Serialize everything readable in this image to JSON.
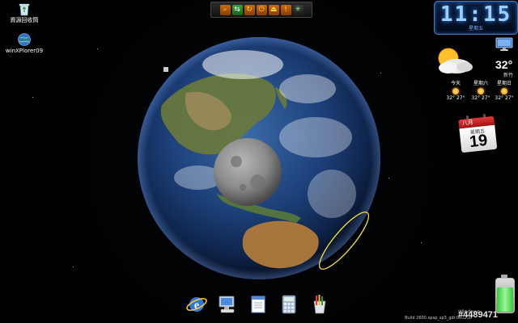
{
  "desktop": {
    "icons": [
      {
        "name": "recycle-bin",
        "label": "資源回收筒",
        "icon": "recycle-bin-icon"
      },
      {
        "name": "winxplorer",
        "label": "winXPlorer09",
        "icon": "globe-icon"
      }
    ]
  },
  "quick_bar": {
    "buttons": [
      {
        "icon": "search-icon",
        "glyph": "⌕"
      },
      {
        "icon": "swap-icon",
        "glyph": "⇆"
      },
      {
        "icon": "refresh-icon",
        "glyph": "↻"
      },
      {
        "icon": "power-icon",
        "glyph": "⏻"
      },
      {
        "icon": "eject-icon",
        "glyph": "⏏"
      },
      {
        "icon": "alert-icon",
        "glyph": "!"
      },
      {
        "icon": "settings-icon",
        "glyph": "✳"
      }
    ]
  },
  "clock": {
    "time": "11:15",
    "subtitle": "星期五"
  },
  "weather": {
    "temperature": "32°",
    "location": "新竹",
    "condition_icon": "partly-cloudy-icon",
    "forecast": [
      {
        "day": "今天",
        "high_low": "32° 27°"
      },
      {
        "day": "星期六",
        "high_low": "32° 27°"
      },
      {
        "day": "星期日",
        "high_low": "32° 27°"
      }
    ]
  },
  "calendar": {
    "month": "八月",
    "weekday": "星期五",
    "day": "19"
  },
  "dock": {
    "items": [
      {
        "icon": "internet-explorer-icon"
      },
      {
        "icon": "my-computer-icon"
      },
      {
        "icon": "notepad-icon"
      },
      {
        "icon": "calculator-icon"
      },
      {
        "icon": "paint-icon"
      }
    ]
  },
  "system": {
    "windows_label": "Windows",
    "build_text": "Build 2600.xpsp_sp3_gdr.080206",
    "watermark": "#4489471",
    "battery_level": 0.75
  },
  "colors": {
    "background": "#000000",
    "clock_digits": "#9ad0ff",
    "calendar_red": "#c0201f",
    "battery_green": "#3ac63a"
  }
}
